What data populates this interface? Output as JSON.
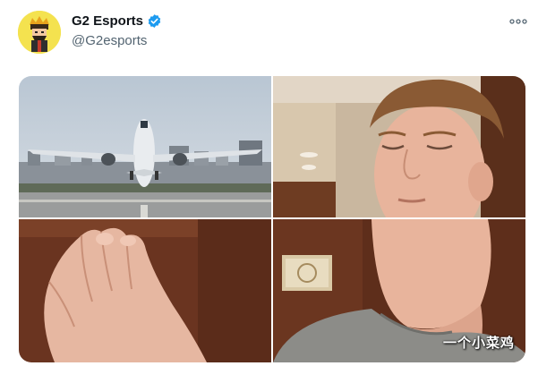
{
  "tweet": {
    "display_name": "G2 Esports",
    "handle": "@G2esports",
    "verified": true,
    "more_icon": "more-horizontal-icon"
  },
  "media": {
    "images": [
      {
        "label": "airplane-taking-off"
      },
      {
        "label": "man-eyes-closed"
      },
      {
        "label": "hands-pinching"
      },
      {
        "label": "chin-raised"
      }
    ],
    "watermark": "一个小菜鸡"
  },
  "colors": {
    "verified_blue": "#1d9bf0",
    "avatar_bg": "#f4e24f",
    "text_primary": "#0f1419",
    "text_secondary": "#536471"
  }
}
